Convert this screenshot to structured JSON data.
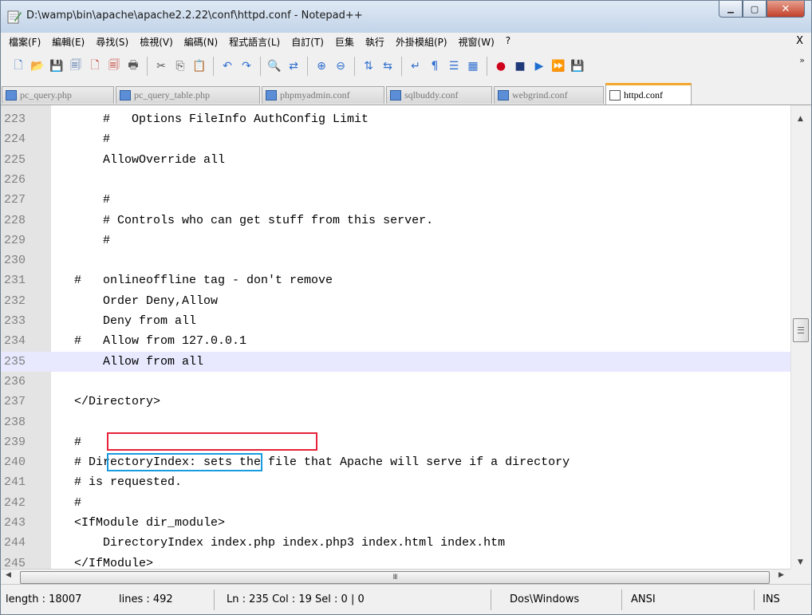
{
  "window": {
    "title": "D:\\wamp\\bin\\apache\\apache2.2.22\\conf\\httpd.conf - Notepad++",
    "min_glyph": "▁",
    "max_glyph": "▢",
    "close_glyph": "✕"
  },
  "menubar": {
    "items": [
      "檔案(F)",
      "編輯(E)",
      "尋找(S)",
      "檢視(V)",
      "編碼(N)",
      "程式語言(L)",
      "自訂(T)",
      "巨集",
      "執行",
      "外掛模組(P)",
      "視窗(W)",
      "?"
    ],
    "close_glyph": "X"
  },
  "toolbar": {
    "buttons": [
      {
        "name": "new-file-icon",
        "glyph": "🗋",
        "color": "#3a6fc4"
      },
      {
        "name": "open-file-icon",
        "glyph": "📂",
        "color": "#d9a400"
      },
      {
        "name": "save-icon",
        "glyph": "💾",
        "color": "#4a6fa5"
      },
      {
        "name": "save-all-icon",
        "glyph": "🗐",
        "color": "#4a6fa5"
      },
      {
        "name": "close-file-icon",
        "glyph": "🗋",
        "color": "#c0392b"
      },
      {
        "name": "close-all-icon",
        "glyph": "🗐",
        "color": "#c0392b"
      },
      {
        "name": "print-icon",
        "glyph": "🖶",
        "color": "#555555"
      },
      {
        "sep": true
      },
      {
        "name": "cut-icon",
        "glyph": "✂",
        "color": "#555555"
      },
      {
        "name": "copy-icon",
        "glyph": "⎘",
        "color": "#555555"
      },
      {
        "name": "paste-icon",
        "glyph": "📋",
        "color": "#b8860b"
      },
      {
        "sep": true
      },
      {
        "name": "undo-icon",
        "glyph": "↶",
        "color": "#2f6fd0"
      },
      {
        "name": "redo-icon",
        "glyph": "↷",
        "color": "#2f6fd0"
      },
      {
        "sep": true
      },
      {
        "name": "find-icon",
        "glyph": "🔍",
        "color": "#333333"
      },
      {
        "name": "replace-icon",
        "glyph": "⇄",
        "color": "#2f6fd0"
      },
      {
        "sep": true
      },
      {
        "name": "zoom-in-icon",
        "glyph": "⊕",
        "color": "#2f6fd0"
      },
      {
        "name": "zoom-out-icon",
        "glyph": "⊖",
        "color": "#2f6fd0"
      },
      {
        "sep": true
      },
      {
        "name": "sync-vertical-icon",
        "glyph": "⇅",
        "color": "#2f6fd0"
      },
      {
        "name": "sync-horizontal-icon",
        "glyph": "⇆",
        "color": "#2f6fd0"
      },
      {
        "sep": true
      },
      {
        "name": "word-wrap-icon",
        "glyph": "↵",
        "color": "#2f6fd0"
      },
      {
        "name": "show-all-chars-icon",
        "glyph": "¶",
        "color": "#2f6fd0"
      },
      {
        "name": "indent-guide-icon",
        "glyph": "☰",
        "color": "#2f6fd0"
      },
      {
        "name": "doc-map-icon",
        "glyph": "▦",
        "color": "#2f6fd0"
      },
      {
        "sep": true
      },
      {
        "name": "macro-record-icon",
        "glyph": "●",
        "color": "#d0021b"
      },
      {
        "name": "macro-stop-icon",
        "glyph": "■",
        "color": "#1f3a7a"
      },
      {
        "name": "macro-play-icon",
        "glyph": "▶",
        "color": "#1f6fd0"
      },
      {
        "name": "macro-run-multiple-icon",
        "glyph": "⏩",
        "color": "#1f6fd0"
      },
      {
        "name": "macro-save-icon",
        "glyph": "💾",
        "color": "#4a6fa5"
      }
    ],
    "overflow_glyph": "»"
  },
  "tabs": [
    {
      "label": "pc_query.php",
      "active": false
    },
    {
      "label": "pc_query_table.php",
      "active": false
    },
    {
      "label": "phpmyadmin.conf",
      "active": false
    },
    {
      "label": "sqlbuddy.conf",
      "active": false
    },
    {
      "label": "webgrind.conf",
      "active": false
    },
    {
      "label": "httpd.conf",
      "active": true
    }
  ],
  "editor": {
    "lines": [
      {
        "num": "223",
        "code": "    #   Options FileInfo AuthConfig Limit"
      },
      {
        "num": "224",
        "code": "    #"
      },
      {
        "num": "225",
        "code": "    AllowOverride all"
      },
      {
        "num": "226",
        "code": ""
      },
      {
        "num": "227",
        "code": "    #"
      },
      {
        "num": "228",
        "code": "    # Controls who can get stuff from this server."
      },
      {
        "num": "229",
        "code": "    #"
      },
      {
        "num": "230",
        "code": ""
      },
      {
        "num": "231",
        "code": "#   onlineoffline tag - don't remove"
      },
      {
        "num": "232",
        "code": "    Order Deny,Allow"
      },
      {
        "num": "233",
        "code": "    Deny from all"
      },
      {
        "num": "234",
        "code": "#   Allow from 127.0.0.1"
      },
      {
        "num": "235",
        "code": "    Allow from all",
        "current": true
      },
      {
        "num": "236",
        "code": ""
      },
      {
        "num": "237",
        "code": "</Directory>"
      },
      {
        "num": "238",
        "code": ""
      },
      {
        "num": "239",
        "code": "#"
      },
      {
        "num": "240",
        "code": "# DirectoryIndex: sets the file that Apache will serve if a directory"
      },
      {
        "num": "241",
        "code": "# is requested."
      },
      {
        "num": "242",
        "code": "#"
      },
      {
        "num": "243",
        "code": "<IfModule dir_module>"
      },
      {
        "num": "244",
        "code": "    DirectoryIndex index.php index.php3 index.html index.htm"
      },
      {
        "num": "245",
        "code": "</IfModule>"
      }
    ],
    "highlight_colors": {
      "red": "#e8223a",
      "blue": "#1a9be0"
    },
    "current_line_color": "#e8e8ff"
  },
  "scroll": {
    "up_glyph": "▲",
    "down_glyph": "▼",
    "left_glyph": "◀",
    "right_glyph": "▶",
    "hthumb_grip": "III"
  },
  "status": {
    "length": "length : 18007",
    "lines": "lines : 492",
    "position": "Ln : 235   Col : 19   Sel : 0 | 0",
    "eol": "Dos\\Windows",
    "encoding": "ANSI",
    "mode": "INS"
  }
}
